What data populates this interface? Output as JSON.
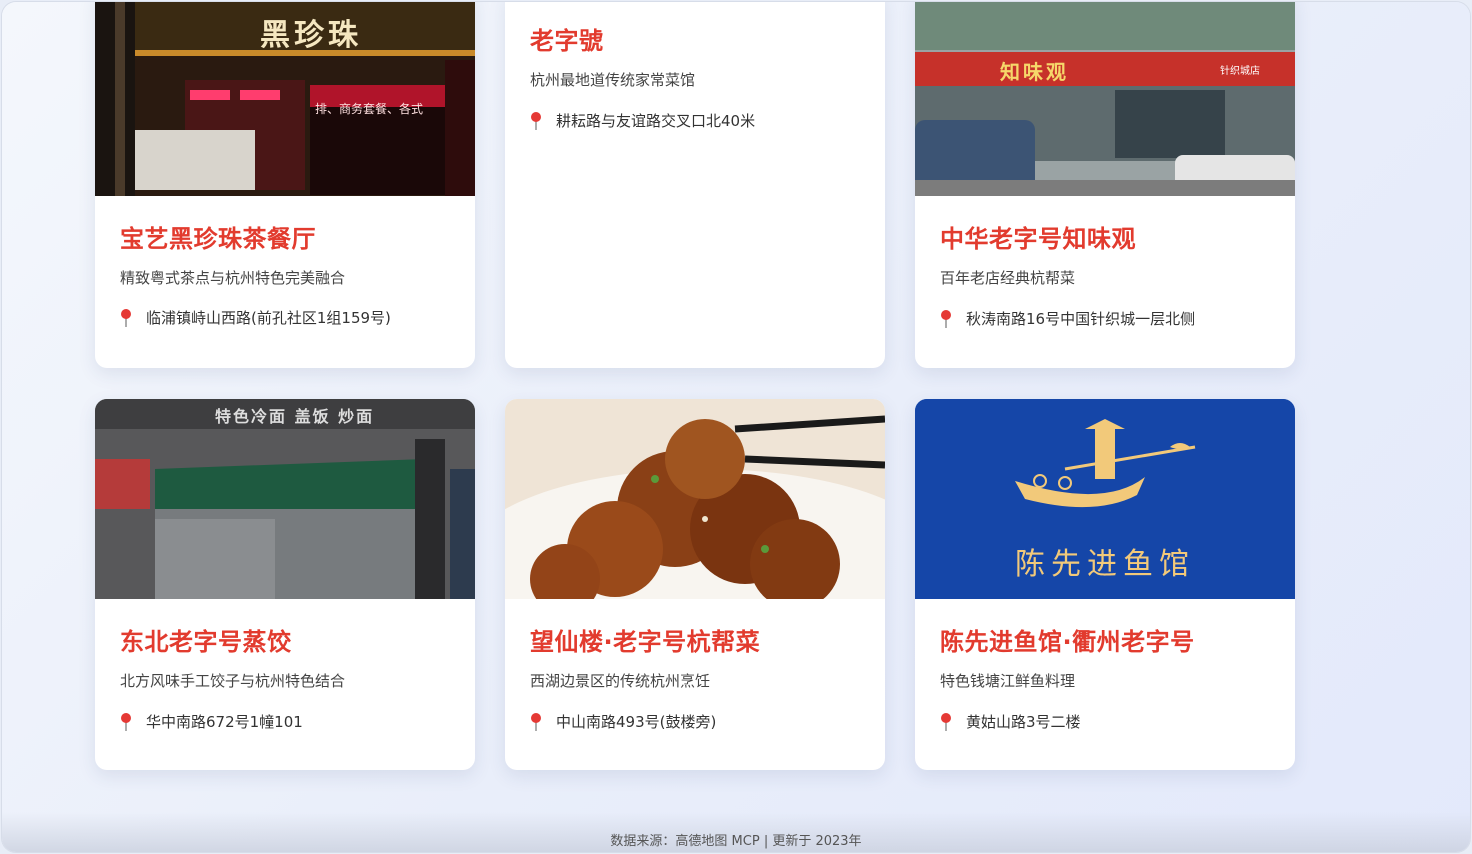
{
  "cards": [
    {
      "name": "宝艺黑珍珠茶餐厅",
      "desc": "精致粤式茶点与杭州特色完美融合",
      "address": "临浦镇峙山西路(前孔社区1组159号)",
      "photo_sign": "黑珍珠",
      "photo_sub": "排、商务套餐、各式"
    },
    {
      "name": "老字號",
      "desc": "杭州最地道传统家常菜馆",
      "address": "耕耘路与友谊路交叉口北40米"
    },
    {
      "name": "中华老字号知味观",
      "desc": "百年老店经典杭帮菜",
      "address": "秋涛南路16号中国针织城一层北侧",
      "photo_sign": "知味观",
      "photo_sub": "针织城店"
    },
    {
      "name": "东北老字号蒸饺",
      "desc": "北方风味手工饺子与杭州特色结合",
      "address": "华中南路672号1幢101",
      "photo_sign": "特色冷面  盖饭  炒面"
    },
    {
      "name": "望仙楼·老字号杭帮菜",
      "desc": "西湖边景区的传统杭州烹饪",
      "address": "中山南路493号(鼓楼旁)"
    },
    {
      "name": "陈先进鱼馆·衢州老字号",
      "desc": "特色钱塘江鲜鱼料理",
      "address": "黄姑山路3号二楼",
      "photo_sign": "陈先进鱼馆"
    }
  ],
  "footer": "数据来源：高德地图 MCP | 更新于 2023年",
  "colors": {
    "name": "#e23b2e",
    "pin": "#e53935",
    "brand_blue": "#1546a8"
  }
}
